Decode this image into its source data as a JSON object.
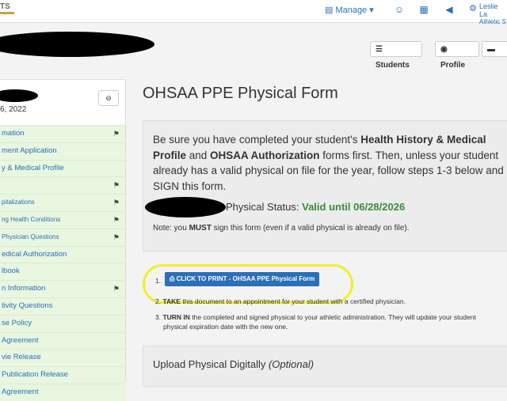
{
  "topbar": {
    "logo_text": "TS",
    "manage_label": "Manage",
    "user_name": "Leslie La",
    "user_role": "Athletic S"
  },
  "header": {
    "students_button": "Students",
    "profile_button": "Profile"
  },
  "sidebar": {
    "date_partial": "6, 2022",
    "items": [
      {
        "label": "mation",
        "flag": true
      },
      {
        "label": "ment Application",
        "flag": false
      },
      {
        "label": "y & Medical Profile",
        "flag": false
      },
      {
        "label": "",
        "flag": true
      },
      {
        "label": "pitalizations",
        "flag": true
      },
      {
        "label": "ng Health Conditions",
        "flag": true
      },
      {
        "label": "Physician Questions",
        "flag": true
      },
      {
        "label": "edical Authorization",
        "flag": false
      },
      {
        "label": "lbook",
        "flag": false
      },
      {
        "label": "n Information",
        "flag": true
      },
      {
        "label": "tivity Questions",
        "flag": false
      },
      {
        "label": "se Policy",
        "flag": false
      },
      {
        "label": "Agreement",
        "flag": false
      },
      {
        "label": "vie Release",
        "flag": false
      },
      {
        "label": "Publication Release",
        "flag": false
      },
      {
        "label": "Agreement",
        "flag": false
      }
    ]
  },
  "main": {
    "title": "OHSAA PPE Physical Form",
    "intro_1": "Be sure you have completed your student's ",
    "intro_b1": "Health History & Medical Profile",
    "intro_2": " and ",
    "intro_b2": "OHSAA Authorization",
    "intro_3": " forms first. Then, unless your student already has a valid physical on file for the year, follow steps 1-3 below and SIGN this form.",
    "status_label": "Physical Status:",
    "status_value": "Valid until 06/28/2026",
    "note_prefix": "Note: you ",
    "note_bold": "MUST",
    "note_suffix": " sign this form (even if a valid physical is already on file).",
    "print_button": "CLICK TO PRINT - OHSAA PPE Physical Form",
    "step2_bold": "TAKE",
    "step2_text": " this document to an appointment for your student with a certified physician.",
    "step3_bold": "TURN IN",
    "step3_text": " the completed and signed physical to your athletic administration. They will update your student",
    "step3_text2": "physical expiration date with the new one.",
    "upload_title": "Upload Physical Digitally",
    "upload_optional": "(Optional)"
  }
}
